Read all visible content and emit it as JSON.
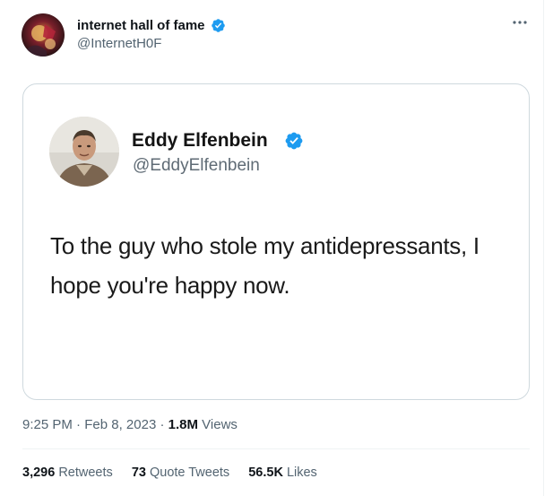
{
  "tweet": {
    "author": {
      "name": "internet hall of fame",
      "handle": "@InternetH0F",
      "verified": true,
      "avatar_icon": "avatar-image"
    },
    "more_icon": "more-horizontal-icon",
    "embedded": {
      "name": "Eddy Elfenbein",
      "handle": "@EddyElfenbein",
      "verified": true,
      "text": "To the guy who stole my antidepressants, I hope you're happy now."
    },
    "meta": {
      "time": "9:25 PM",
      "sep1": "·",
      "date": "Feb 8, 2023",
      "sep2": "·",
      "views_count": "1.8M",
      "views_label": "Views"
    },
    "stats": {
      "retweets_count": "3,296",
      "retweets_label": "Retweets",
      "quotes_count": "73",
      "quotes_label": "Quote Tweets",
      "likes_count": "56.5K",
      "likes_label": "Likes"
    }
  },
  "colors": {
    "verified_blue": "#1d9bf0",
    "secondary_text": "#536471",
    "border": "#cfd9de"
  }
}
